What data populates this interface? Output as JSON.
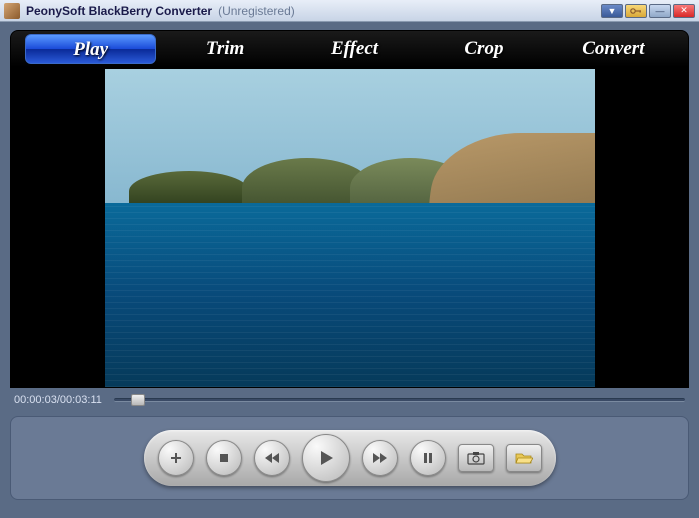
{
  "title": "PeonySoft BlackBerry Converter",
  "status": "(Unregistered)",
  "tabs": {
    "play": "Play",
    "trim": "Trim",
    "effect": "Effect",
    "crop": "Crop",
    "convert": "Convert"
  },
  "active_tab": "play",
  "time": {
    "current": "00:00:03",
    "total": "00:03:11",
    "sep": "/"
  },
  "progress_percent": 3,
  "controls": {
    "add": "add",
    "stop": "stop",
    "rewind": "rewind",
    "play": "play",
    "forward": "forward",
    "pause": "pause",
    "snapshot": "snapshot",
    "open": "open"
  },
  "titlebar_buttons": {
    "dropdown": "▼",
    "key": "key",
    "minimize": "—",
    "close": "✕"
  }
}
